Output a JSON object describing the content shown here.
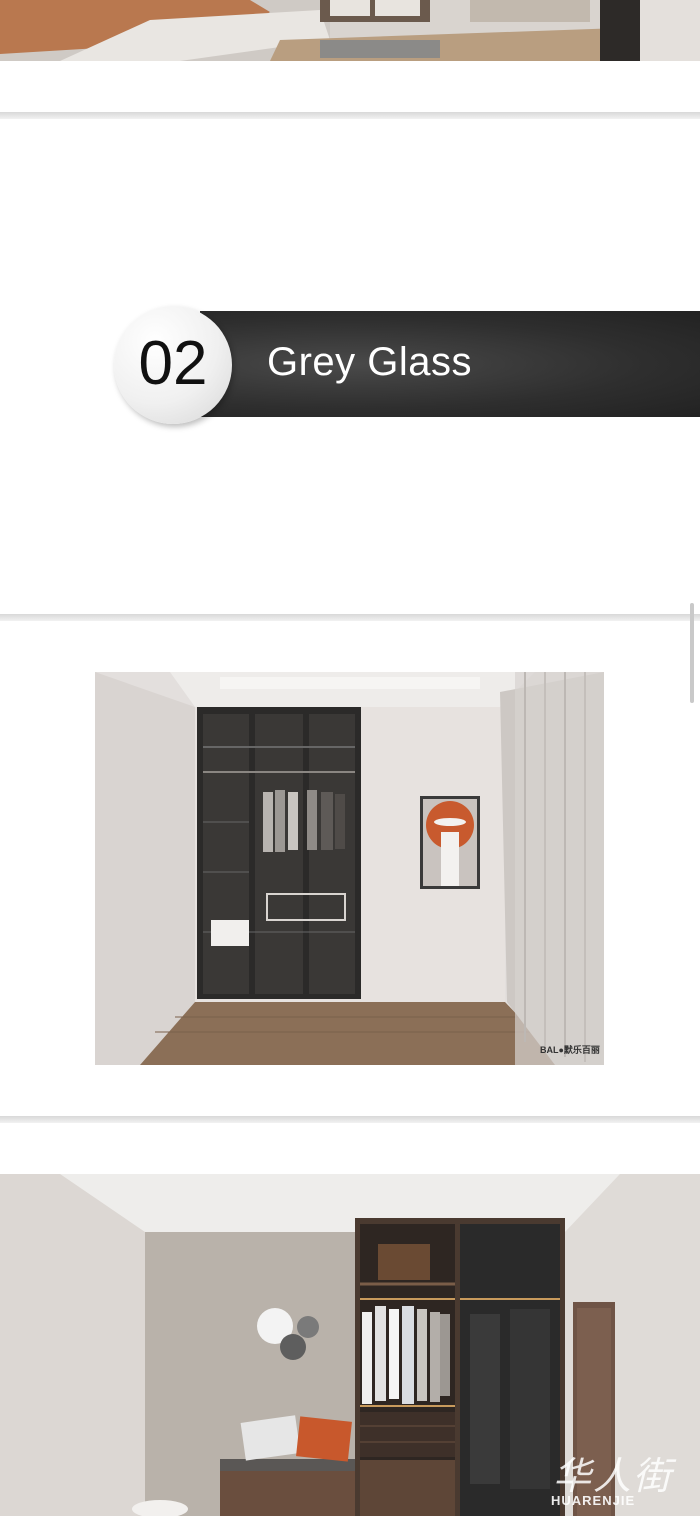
{
  "section": {
    "number": "02",
    "title": "Grey Glass"
  },
  "wardrobe_brand": "BAL●默乐百丽",
  "watermark": {
    "chinese": "华人街",
    "english": "HUARENJIE"
  },
  "colors": {
    "band": "#2e2e2e",
    "page_bg": "#ffffff",
    "divider": "#dcdcdc"
  }
}
